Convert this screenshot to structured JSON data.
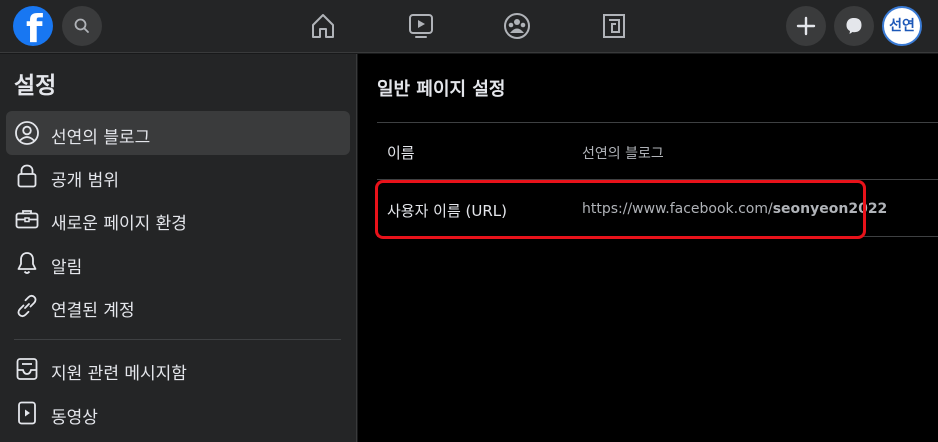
{
  "topbar": {
    "logo_letter": "f",
    "avatar_text": "선연",
    "icons": [
      "facebook-logo",
      "search-icon",
      "home-icon",
      "watch-icon",
      "groups-icon",
      "gaming-icon",
      "plus-icon",
      "messenger-icon"
    ]
  },
  "sidebar": {
    "title": "설정",
    "items": [
      {
        "label": "선연의 블로그",
        "icon": "profile-icon"
      },
      {
        "label": "공개 범위",
        "icon": "lock-icon"
      },
      {
        "label": "새로운 페이지 환경",
        "icon": "briefcase-icon"
      },
      {
        "label": "알림",
        "icon": "bell-icon"
      },
      {
        "label": "연결된 계정",
        "icon": "link-icon"
      },
      {
        "label": "지원 관련 메시지함",
        "icon": "inbox-icon"
      },
      {
        "label": "동영상",
        "icon": "video-icon"
      }
    ]
  },
  "main": {
    "title": "일반 페이지 설정",
    "rows": [
      {
        "label": "이름",
        "value": "선연의 블로그"
      },
      {
        "label": "사용자 이름 (URL)",
        "value_prefix": "https://www.facebook.com/",
        "value_bold": "seonyeon2022"
      }
    ]
  },
  "colors": {
    "accent": "#1877f2",
    "highlight_border": "#e8121a",
    "background": "#18191a"
  }
}
